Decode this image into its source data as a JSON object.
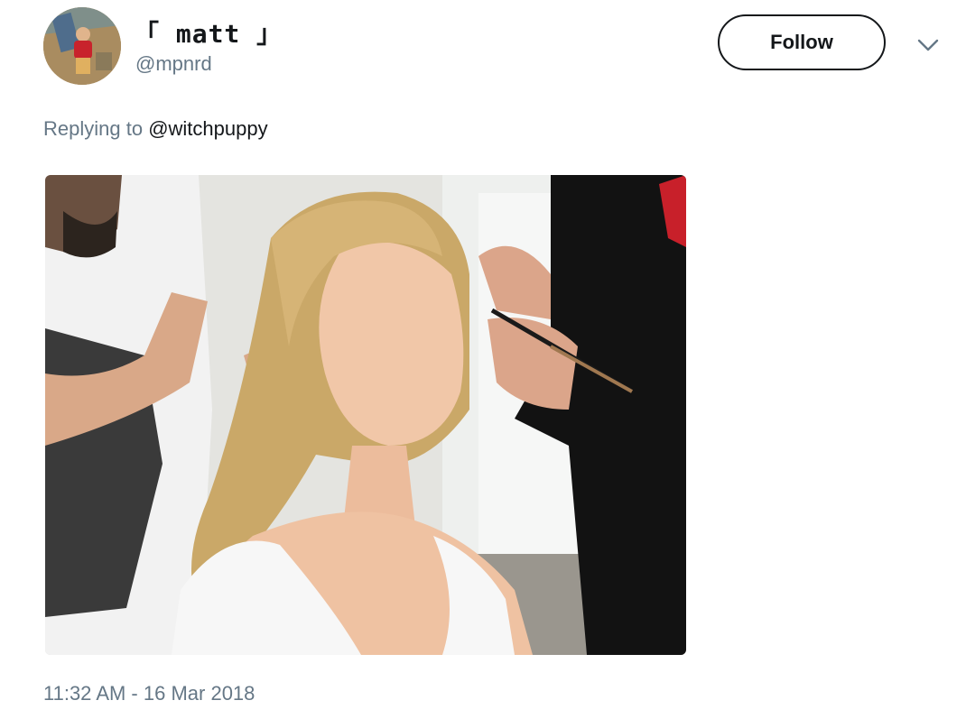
{
  "user": {
    "display_name": "「 matt 」",
    "handle": "@mpnrd"
  },
  "actions": {
    "follow_label": "Follow",
    "more_icon": "chevron-down-icon"
  },
  "reply": {
    "prefix": "Replying to ",
    "to_handle": "@witchpuppy"
  },
  "meta": {
    "timestamp": "11:32 AM - 16 Mar 2018"
  },
  "colors": {
    "text_primary": "#14171a",
    "text_secondary": "#657786",
    "background": "#ffffff"
  }
}
